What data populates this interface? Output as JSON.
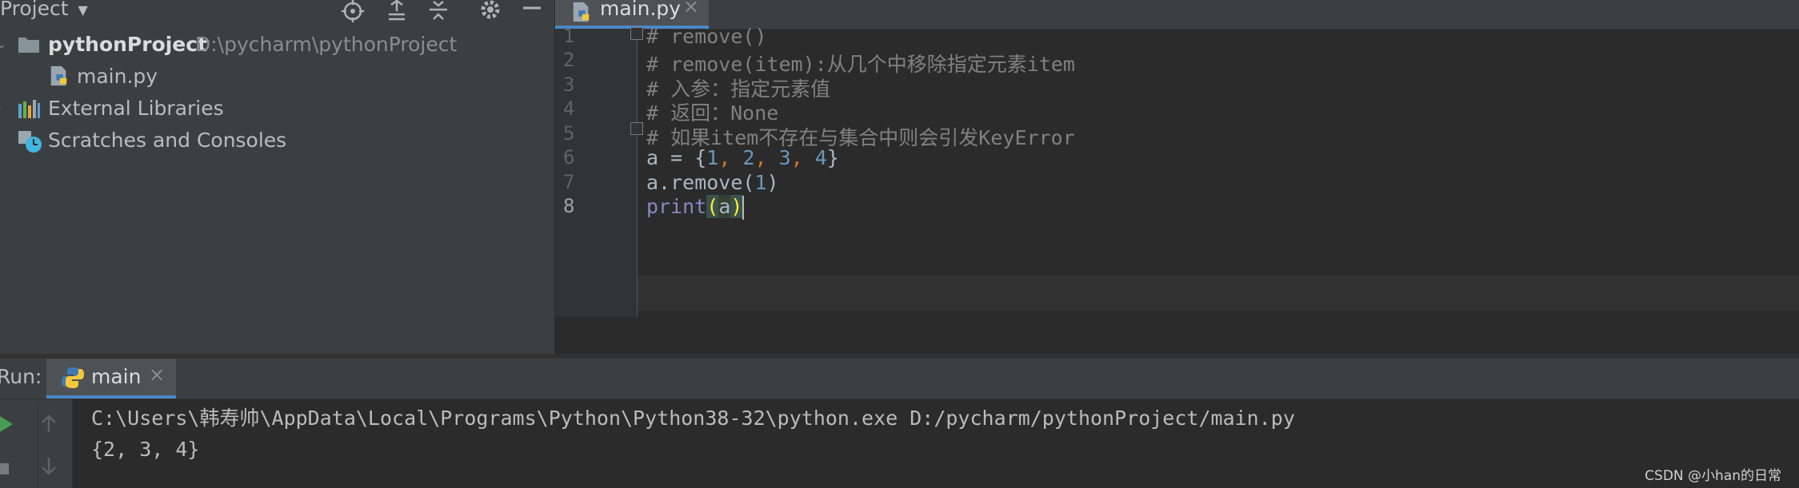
{
  "project_panel": {
    "title": "Project",
    "tree": [
      {
        "label": "pythonProject",
        "path": "D:\\pycharm\\pythonProject"
      },
      {
        "label": "main.py"
      },
      {
        "label": "External Libraries"
      },
      {
        "label": "Scratches and Consoles"
      }
    ]
  },
  "editor": {
    "tab_label": "main.py",
    "line_numbers": [
      "1",
      "2",
      "3",
      "4",
      "5",
      "6",
      "7",
      "8"
    ],
    "current_line": 8,
    "lines": [
      {
        "comment": "# remove()"
      },
      {
        "comment": "# remove(item):从几个中移除指定元素item"
      },
      {
        "comment": "# 入参：指定元素值"
      },
      {
        "comment": "# 返回：None"
      },
      {
        "comment": "# 如果item不存在与集合中则会引发KeyError"
      },
      {
        "p1": "a = {",
        "n1": "1",
        "c1": ", ",
        "n2": "2",
        "c2": ", ",
        "n3": "3",
        "c3": ", ",
        "n4": "4",
        "p2": "}"
      },
      {
        "p1": "a.remove(",
        "n1": "1",
        "p2": ")"
      },
      {
        "fn": "print",
        "open": "(",
        "arg": "a",
        "close": ")"
      }
    ]
  },
  "run_panel": {
    "label": "Run:",
    "tab_label": "main",
    "output": [
      "C:\\Users\\韩寿帅\\AppData\\Local\\Programs\\Python\\Python38-32\\python.exe D:/pycharm/pythonProject/main.py",
      "{2, 3, 4}"
    ]
  },
  "watermark": "CSDN @小han的日常",
  "colors": {
    "panel_bg": "#3c3f41",
    "editor_bg": "#2b2b2b",
    "comment": "#808080",
    "number": "#6897bb",
    "keyword_punc": "#cc7832",
    "builtin": "#8888c6",
    "accent": "#4a88c7"
  }
}
